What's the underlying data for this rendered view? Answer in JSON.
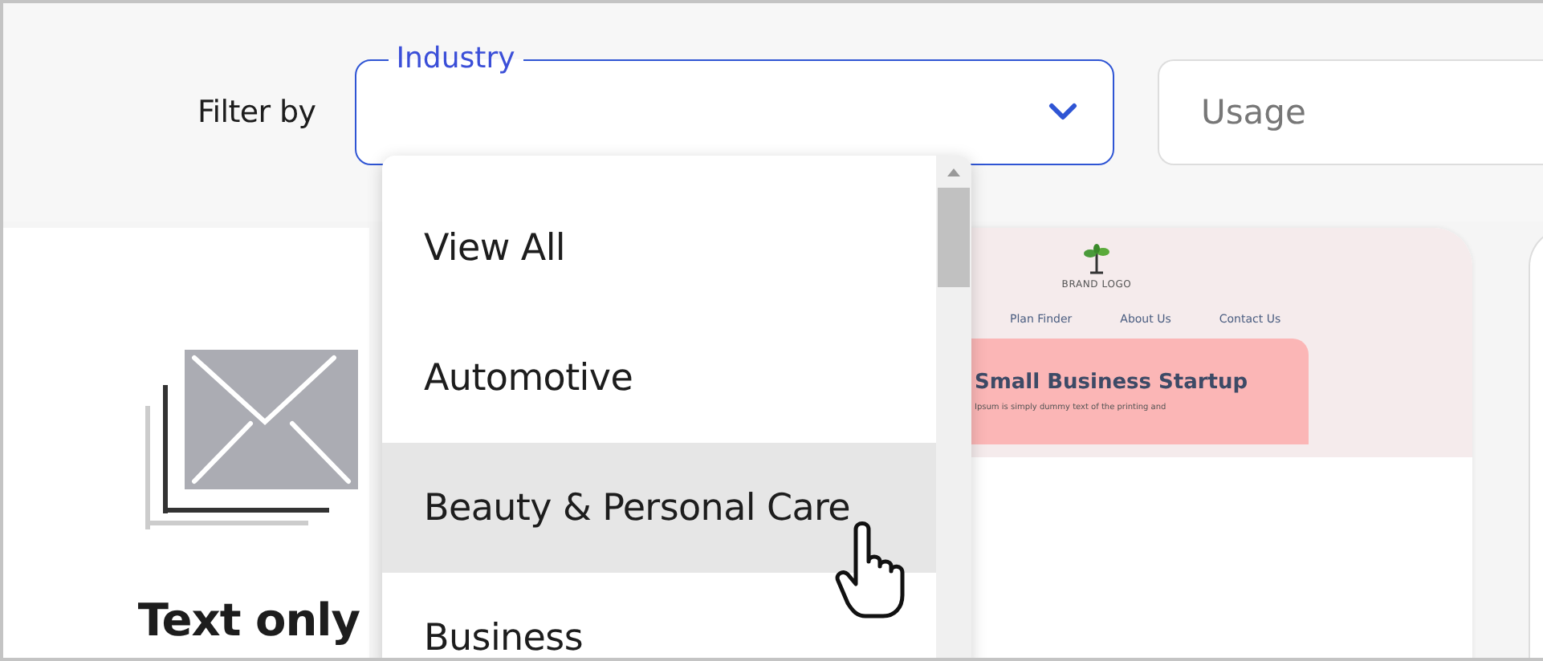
{
  "filter_bar": {
    "label": "Filter by",
    "industry_select": {
      "label": "Industry",
      "expanded": true
    },
    "usage_field": {
      "placeholder": "Usage"
    }
  },
  "cards": [
    {
      "kind": "text",
      "title": "Text only"
    },
    {
      "kind": "template",
      "brand": "BRAND LOGO",
      "nav": [
        "Plan Finder",
        "About Us",
        "Contact Us"
      ],
      "headline": "Small Business Startup",
      "subtext": "Ipsum is simply dummy text of the printing and"
    },
    {
      "kind": "blank"
    }
  ],
  "dropdown": {
    "items": [
      {
        "label": "View All",
        "highlighted": false
      },
      {
        "label": "Automotive",
        "highlighted": false
      },
      {
        "label": "Beauty & Personal Care",
        "highlighted": true
      },
      {
        "label": "Business",
        "highlighted": false
      }
    ]
  }
}
